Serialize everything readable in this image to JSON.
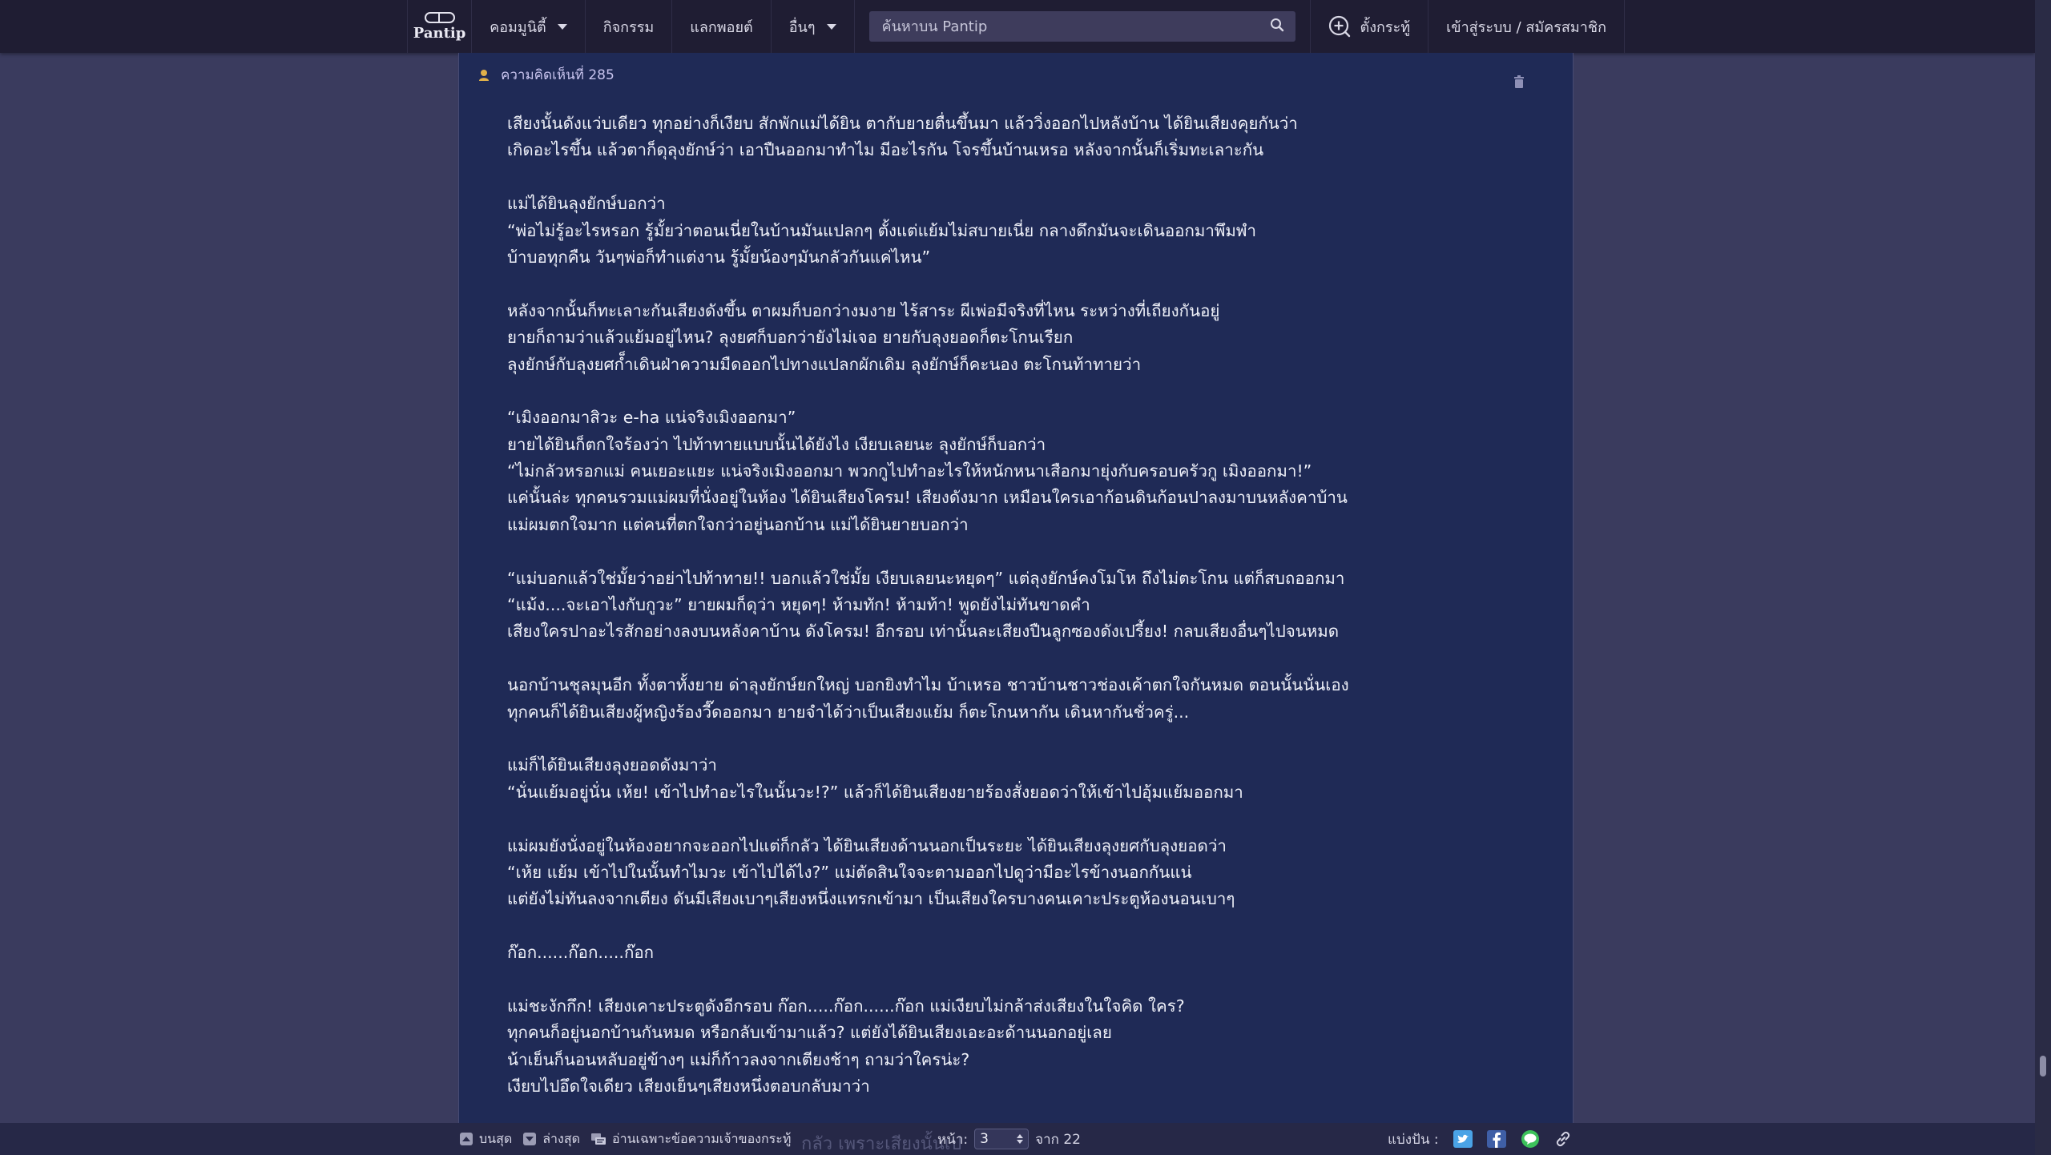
{
  "topnav": {
    "logo_text": "Pantip",
    "items": [
      {
        "label": "คอมมูนิตี้",
        "has_caret": true
      },
      {
        "label": "กิจกรรม",
        "has_caret": false
      },
      {
        "label": "แลกพอยต์",
        "has_caret": false
      },
      {
        "label": "อื่นๆ",
        "has_caret": true
      }
    ],
    "search_placeholder": "ค้นหาบน Pantip",
    "new_topic_label": "ตั้งกระทู้",
    "login_label": "เข้าสู่ระบบ / สมัครสมาชิก"
  },
  "comment": {
    "header": "ความคิดเห็นที่ 285",
    "paragraphs": [
      [
        "เสียงนั้นดังแว่บเดียว ทุกอย่างก็เงียบ สักพักแม่ได้ยิน ตากับยายตื่นขึ้นมา แล้ววิ่งออกไปหลังบ้าน ได้ยินเสียงคุยกันว่า",
        "เกิดอะไรขึ้น แล้วตาก็ดุลุงยักษ์ว่า เอาปืนออกมาทำไม มีอะไรกัน โจรขึ้นบ้านเหรอ หลังจากนั้นก็เริ่มทะเลาะกัน"
      ],
      [
        "แม่ได้ยินลุงยักษ์บอกว่า",
        "“พ่อไม่รู้อะไรหรอก รู้มั้ยว่าตอนเนี่ยในบ้านมันแปลกๆ ตั้งแต่แย้มไม่สบายเนี่ย กลางดึกมันจะเดินออกมาพึมพำ",
        "บ้าบอทุกคืน วันๆพ่อก็ทำแต่งาน รู้มั้ยน้องๆมันกลัวกันแค่ไหน”"
      ],
      [
        "หลังจากนั้นก็ทะเลาะกันเสียงดังขึ้น ตาผมก็บอกว่างมงาย ไร้สาระ ผีเพ่อมีจริงที่ไหน ระหว่างที่เถียงกันอยู่",
        "ยายก็ถามว่าแล้วแย้มอยู่ไหน? ลุงยศก็บอกว่ายังไม่เจอ ยายกับลุงยอดก็ตะโกนเรียก",
        "ลุงยักษ์กับลุงยศก็ำเดินฝ่าความมืดออกไปทางแปลกผักเดิม ลุงยักษ์ก็คะนอง ตะโกนท้าทายว่า"
      ],
      [
        "“เมิงออกมาสิวะ e-ha แน่จริงเมิงออกมา”",
        "ยายได้ยินก็ตกใจร้องว่า ไปท้าทายแบบนั้นได้ยังไง เงียบเลยนะ ลุงยักษ์ก็บอกว่า",
        "“ไม่กลัวหรอกแม่ คนเยอะแยะ แน่จริงเมิงออกมา พวกกูไปทำอะไรให้หนักหนาเสือกมายุ่งกับครอบครัวกู เมิงออกมา!”",
        "แค่นั้นล่ะ ทุกคนรวมแม่ผมที่นั่งอยู่ในห้อง ได้ยินเสียงโครม! เสียงดังมาก เหมือนใครเอาก้อนดินก้อนปาลงมาบนหลังคาบ้าน",
        "แม่ผมตกใจมาก แต่คนที่ตกใจกว่าอยู่นอกบ้าน แม่ได้ยินยายบอกว่า"
      ],
      [
        "“แม่บอกแล้วใช่มั้ยว่าอย่าไปท้าทาย!! บอกแล้วใช่มั้ย เงียบเลยนะหยุดๆ” แต่ลุงยักษ์คงโมโห ถึงไม่ตะโกน แต่ก็สบถออกมา",
        "“แม้ง....จะเอาไงกับกูวะ” ยายผมก็ดุว่า หยุดๆ! ห้ามทัก! ห้ามท้า! พูดยังไม่ทันขาดคำ",
        "เสียงใครปาอะไรสักอย่างลงบนหลังคาบ้าน ดังโครม! อีกรอบ เท่านั้นละเสียงปืนลูกซองดังเปรี้ยง! กลบเสียงอื่นๆไปจนหมด"
      ],
      [
        "นอกบ้านชุลมุนอีก ทั้งตาทั้งยาย ด่าลุงยักษ์ยกใหญ่ บอกยิงทำไม บ้าเหรอ ชาวบ้านชาวช่องเค้าตกใจกันหมด ตอนนั้นนั่นเอง",
        "ทุกคนก็ได้ยินเสียงผู้หญิงร้องวี๊ดออกมา ยายจำได้ว่าเป็นเสียงแย้ม ก็ตะโกนหากัน เดินหากันชั่วครู่..."
      ],
      [
        "แม่ก็ได้ยินเสียงลุงยอดดังมาว่า",
        "“นั่นแย้มอยู่นั่น เห้ย! เข้าไปทำอะไรในนั้นวะ!?” แล้วก็ได้ยินเสียงยายร้องสั่งยอดว่าให้เข้าไปอุ้มแย้มออกมา"
      ],
      [
        "แม่ผมยังนั่งอยู่ในห้องอยากจะออกไปแต่ก็กลัว ได้ยินเสียงด้านนอกเป็นระยะ ได้ยินเสียงลุงยศกับลุงยอดว่า",
        "“เห้ย แย้ม เข้าไปในนั้นทำไมวะ เข้าไปได้ไง?” แม่ตัดสินใจจะตามออกไปดูว่ามีอะไรข้างนอกกันแน่",
        "แต่ยังไม่ทันลงจากเตียง ดันมีเสียงเบาๆเสียงหนึ่งแทรกเข้ามา เป็นเสียงใครบางคนเคาะประตูห้องนอนเบาๆ"
      ],
      [
        "ก๊อก......ก๊อก.....ก๊อก"
      ],
      [
        "แม่ชะงักกึก! เสียงเคาะประตูดังอีกรอบ ก๊อก.....ก๊อก......ก๊อก แม่เงียบไม่กล้าส่งเสียงในใจคิด ใคร?",
        "ทุกคนก็อยู่นอกบ้านกันหมด หรือกลับเข้ามาแล้ว? แต่ยังได้ยินเสียงเอะอะด้านนอกอยู่เลย",
        "น้าเย็นก็นอนหลับอยู่ข้างๆ แม่ก็ก้าวลงจากเตียงช้าๆ ถามว่าใครน่ะ?",
        "เงียบไปอึดใจเดียว เสียงเย็นๆเสียงหนึ่งตอบกลับมาว่า"
      ]
    ]
  },
  "bottombar": {
    "top_label": "บนสุด",
    "bottom_label": "ล่างสุด",
    "owner_only_label": "อ่านเฉพาะข้อความเจ้าของกระทู้",
    "ghost_text": "กลัว เพราะเสียงนั้นเป",
    "page_label": "หน้า:",
    "current_page": "3",
    "total_label": "จาก 22",
    "share_label": "แบ่งปัน :"
  },
  "colors": {
    "topbar": "#1f1d33",
    "background": "#3a3b5e",
    "panel": "#1f2a56",
    "text": "#eef0f8",
    "header_text": "#c8c4ee",
    "twitter": "#4aa3e6",
    "facebook": "#3f5fa6",
    "line": "#3cc15b"
  },
  "icons": {
    "search": "search-icon",
    "new_topic": "plus-circle-icon",
    "avatar": "user-avatar-icon",
    "trash": "trash-icon",
    "twitter": "twitter-icon",
    "facebook": "facebook-icon",
    "line": "line-icon",
    "link": "link-icon"
  }
}
